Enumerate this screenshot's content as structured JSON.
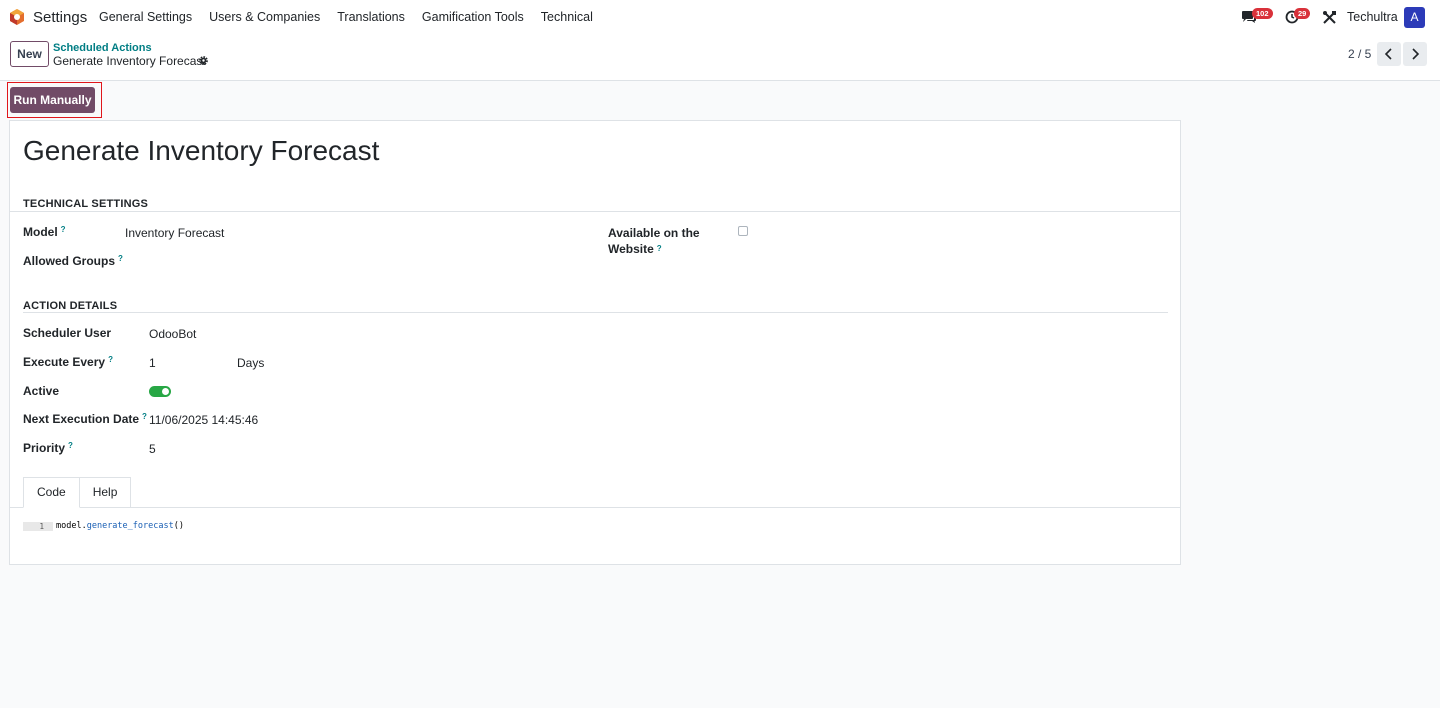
{
  "navbar": {
    "app_name": "Settings",
    "menu": [
      "General Settings",
      "Users & Companies",
      "Translations",
      "Gamification Tools",
      "Technical"
    ],
    "messages_count": "102",
    "activities_count": "29",
    "company": "Techultra",
    "avatar_letter": "A",
    "icons": [
      "odoo-app-icon",
      "chat-icon",
      "clock-icon",
      "debug-tools-icon"
    ]
  },
  "control_panel": {
    "new_label": "New",
    "breadcrumb_parent": "Scheduled Actions",
    "breadcrumb_current": "Generate Inventory Forecast",
    "pager_value": "2 / 5"
  },
  "status_bar": {
    "run_manually_label": "Run Manually"
  },
  "form": {
    "title": "Generate Inventory Forecast",
    "technical_settings": {
      "section_title": "TECHNICAL SETTINGS",
      "model_label": "Model",
      "model_value": "Inventory Forecast",
      "allowed_groups_label": "Allowed Groups",
      "website_label_line1": "Available on the",
      "website_label_line2": "Website",
      "website_checked": false
    },
    "action_details": {
      "section_title": "ACTION DETAILS",
      "scheduler_user_label": "Scheduler User",
      "scheduler_user_value": "OdooBot",
      "execute_every_label": "Execute Every",
      "execute_every_value": "1",
      "execute_every_unit": "Days",
      "active_label": "Active",
      "active_value": true,
      "next_exec_label": "Next Execution Date",
      "next_exec_value": "11/06/2025 14:45:46",
      "priority_label": "Priority",
      "priority_value": "5"
    },
    "help_marker": "?",
    "tabs": [
      "Code",
      "Help"
    ],
    "active_tab": "Code",
    "code": {
      "line_number": "1",
      "object": "model",
      "dot": ".",
      "call": "generate_forecast",
      "parens": "()"
    }
  },
  "colors": {
    "brand": "#714b67",
    "teal": "#017e84",
    "badge": "#d9313a",
    "toggle_on": "#28a745",
    "highlight": "#e0161b"
  }
}
